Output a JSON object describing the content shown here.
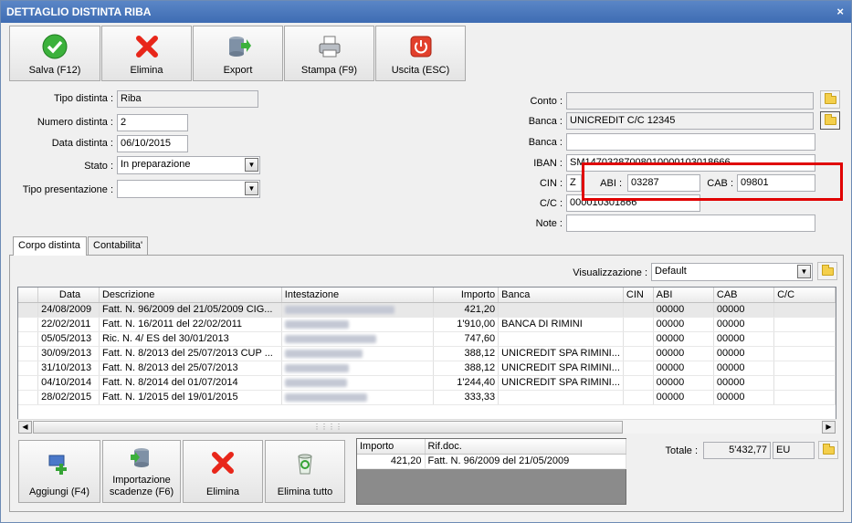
{
  "window": {
    "title": "DETTAGLIO DISTINTA RIBA",
    "close_glyph": "×"
  },
  "toolbar": [
    {
      "label": "Salva (F12)",
      "icon": "check-icon"
    },
    {
      "label": "Elimina",
      "icon": "delete-x-icon"
    },
    {
      "label": "Export",
      "icon": "database-export-icon"
    },
    {
      "label": "Stampa (F9)",
      "icon": "printer-icon"
    },
    {
      "label": "Uscita (ESC)",
      "icon": "power-icon"
    }
  ],
  "left_form": {
    "tipo_distinta": {
      "label": "Tipo distinta :",
      "value": "Riba"
    },
    "numero_distinta": {
      "label": "Numero distinta :",
      "value": "2"
    },
    "data_distinta": {
      "label": "Data distinta :",
      "value": "06/10/2015"
    },
    "stato": {
      "label": "Stato :",
      "value": "In preparazione"
    },
    "tipo_presentazione": {
      "label": "Tipo presentazione :",
      "value": ""
    }
  },
  "right_form": {
    "conto": {
      "label": "Conto :",
      "value": ""
    },
    "banca1": {
      "label": "Banca :",
      "value": "UNICREDIT C/C 12345"
    },
    "banca2": {
      "label": "Banca :",
      "value": ""
    },
    "iban": {
      "label": "IBAN :",
      "value": "SM14703287008010000103018666"
    },
    "cin": {
      "label": "CIN :",
      "value": "Z"
    },
    "abi": {
      "label": "ABI :",
      "value": "03287"
    },
    "cab": {
      "label": "CAB :",
      "value": "09801"
    },
    "cc": {
      "label": "C/C :",
      "value": "000010301866"
    },
    "note": {
      "label": "Note :",
      "value": ""
    }
  },
  "tabs": [
    {
      "label": "Corpo distinta",
      "active": true
    },
    {
      "label": "Contabilita'",
      "active": false
    }
  ],
  "visualizzazione": {
    "label": "Visualizzazione :",
    "value": "Default"
  },
  "grid": {
    "columns": [
      "",
      "Data",
      "Descrizione",
      "Intestazione",
      "Importo",
      "Banca",
      "CIN",
      "ABI",
      "CAB",
      "C/C"
    ],
    "rows": [
      {
        "data": "24/08/2009",
        "descrizione": "Fatt. N. 96/2009 del 21/05/2009  CIG...",
        "importo": "421,20",
        "banca": "",
        "abi": "00000",
        "cab": "00000"
      },
      {
        "data": "22/02/2011",
        "descrizione": "Fatt. N. 16/2011 del 22/02/2011",
        "importo": "1'910,00",
        "banca": "BANCA DI RIMINI",
        "abi": "00000",
        "cab": "00000"
      },
      {
        "data": "05/05/2013",
        "descrizione": "Ric. N. 4/ ES del 30/01/2013",
        "importo": "747,60",
        "banca": "",
        "abi": "00000",
        "cab": "00000"
      },
      {
        "data": "30/09/2013",
        "descrizione": "Fatt. N. 8/2013 del 25/07/2013 CUP ...",
        "importo": "388,12",
        "banca": "UNICREDIT SPA RIMINI...",
        "abi": "00000",
        "cab": "00000"
      },
      {
        "data": "31/10/2013",
        "descrizione": "Fatt. N. 8/2013 del 25/07/2013",
        "importo": "388,12",
        "banca": "UNICREDIT SPA RIMINI...",
        "abi": "00000",
        "cab": "00000"
      },
      {
        "data": "04/10/2014",
        "descrizione": "Fatt. N. 8/2014 del 01/07/2014",
        "importo": "1'244,40",
        "banca": "UNICREDIT SPA RIMINI...",
        "abi": "00000",
        "cab": "00000"
      },
      {
        "data": "28/02/2015",
        "descrizione": "Fatt. N. 1/2015 del 19/01/2015",
        "importo": "333,33",
        "banca": "",
        "abi": "00000",
        "cab": "00000"
      }
    ]
  },
  "bottom_buttons": [
    {
      "label": "Aggiungi (F4)",
      "icon": "add-icon"
    },
    {
      "label": "Importazione scadenze (F6)",
      "icon": "database-import-icon"
    },
    {
      "label": "Elimina",
      "icon": "delete-x-icon"
    },
    {
      "label": "Elimina tutto",
      "icon": "recycle-bin-icon"
    }
  ],
  "subgrid": {
    "columns": [
      "Importo",
      "Rif.doc."
    ],
    "rows": [
      {
        "importo": "421,20",
        "rif": "Fatt. N. 96/2009 del 21/05/2009"
      }
    ]
  },
  "totale": {
    "label": "Totale :",
    "value": "5'432,77",
    "currency": "EU"
  }
}
